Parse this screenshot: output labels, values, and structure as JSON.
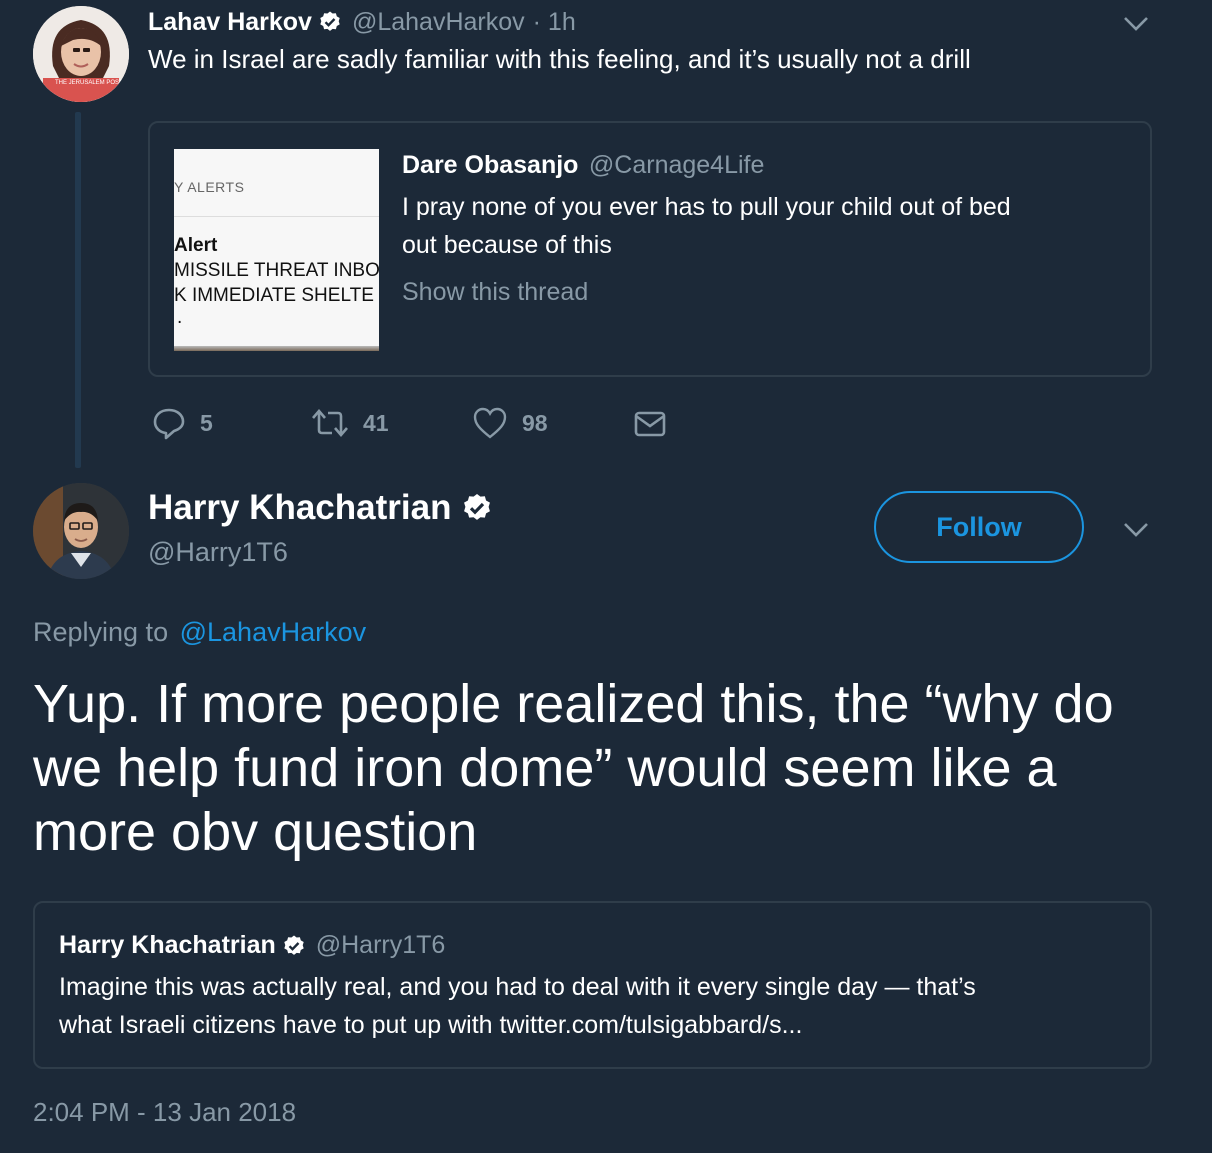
{
  "tweet1": {
    "author_name": "Lahav Harkov",
    "handle": "@LahavHarkov",
    "time": "· 1h",
    "text": "We in Israel are sadly familiar with this feeling, and it’s usually not a drill",
    "avatar_caption": "THE JERUSALEM POST",
    "quoted": {
      "author_name": "Dare Obasanjo",
      "handle": "@Carnage4Life",
      "text_line1": "I pray none of you ever has to pull your child out of bed",
      "text_line2": "out because of this",
      "show_thread": "Show this thread",
      "thumb": {
        "header": "Y ALERTS",
        "line1": "Alert",
        "line2": "MISSILE THREAT INBO",
        "line3": "K IMMEDIATE SHELTE",
        "line4": "."
      }
    },
    "actions": {
      "reply_count": "5",
      "retweet_count": "41",
      "like_count": "98"
    }
  },
  "tweet2": {
    "author_name": "Harry Khachatrian",
    "handle": "@Harry1T6",
    "follow_label": "Follow",
    "replying_prefix": "Replying to",
    "replying_to": "@LahavHarkov",
    "text_line1": "Yup. If more people realized this, the “why do",
    "text_line2": "we help fund iron dome” would seem like a",
    "text_line3": "more obv question",
    "quoted": {
      "author_name": "Harry Khachatrian",
      "handle": "@Harry1T6",
      "text_line1": "Imagine this was actually real, and you had to deal with it every single day — that’s",
      "text_line2": "what Israeli citizens have to put up with twitter.com/tulsigabbard/s..."
    },
    "timestamp": "2:04 PM - 13 Jan 2018"
  },
  "colors": {
    "background": "#1c2938",
    "accent": "#1b95e0",
    "muted": "#8899a6",
    "border": "#2f3d4a"
  },
  "icons": [
    "verified-badge-icon",
    "chevron-down-icon",
    "reply-icon",
    "retweet-icon",
    "like-icon",
    "message-icon"
  ]
}
